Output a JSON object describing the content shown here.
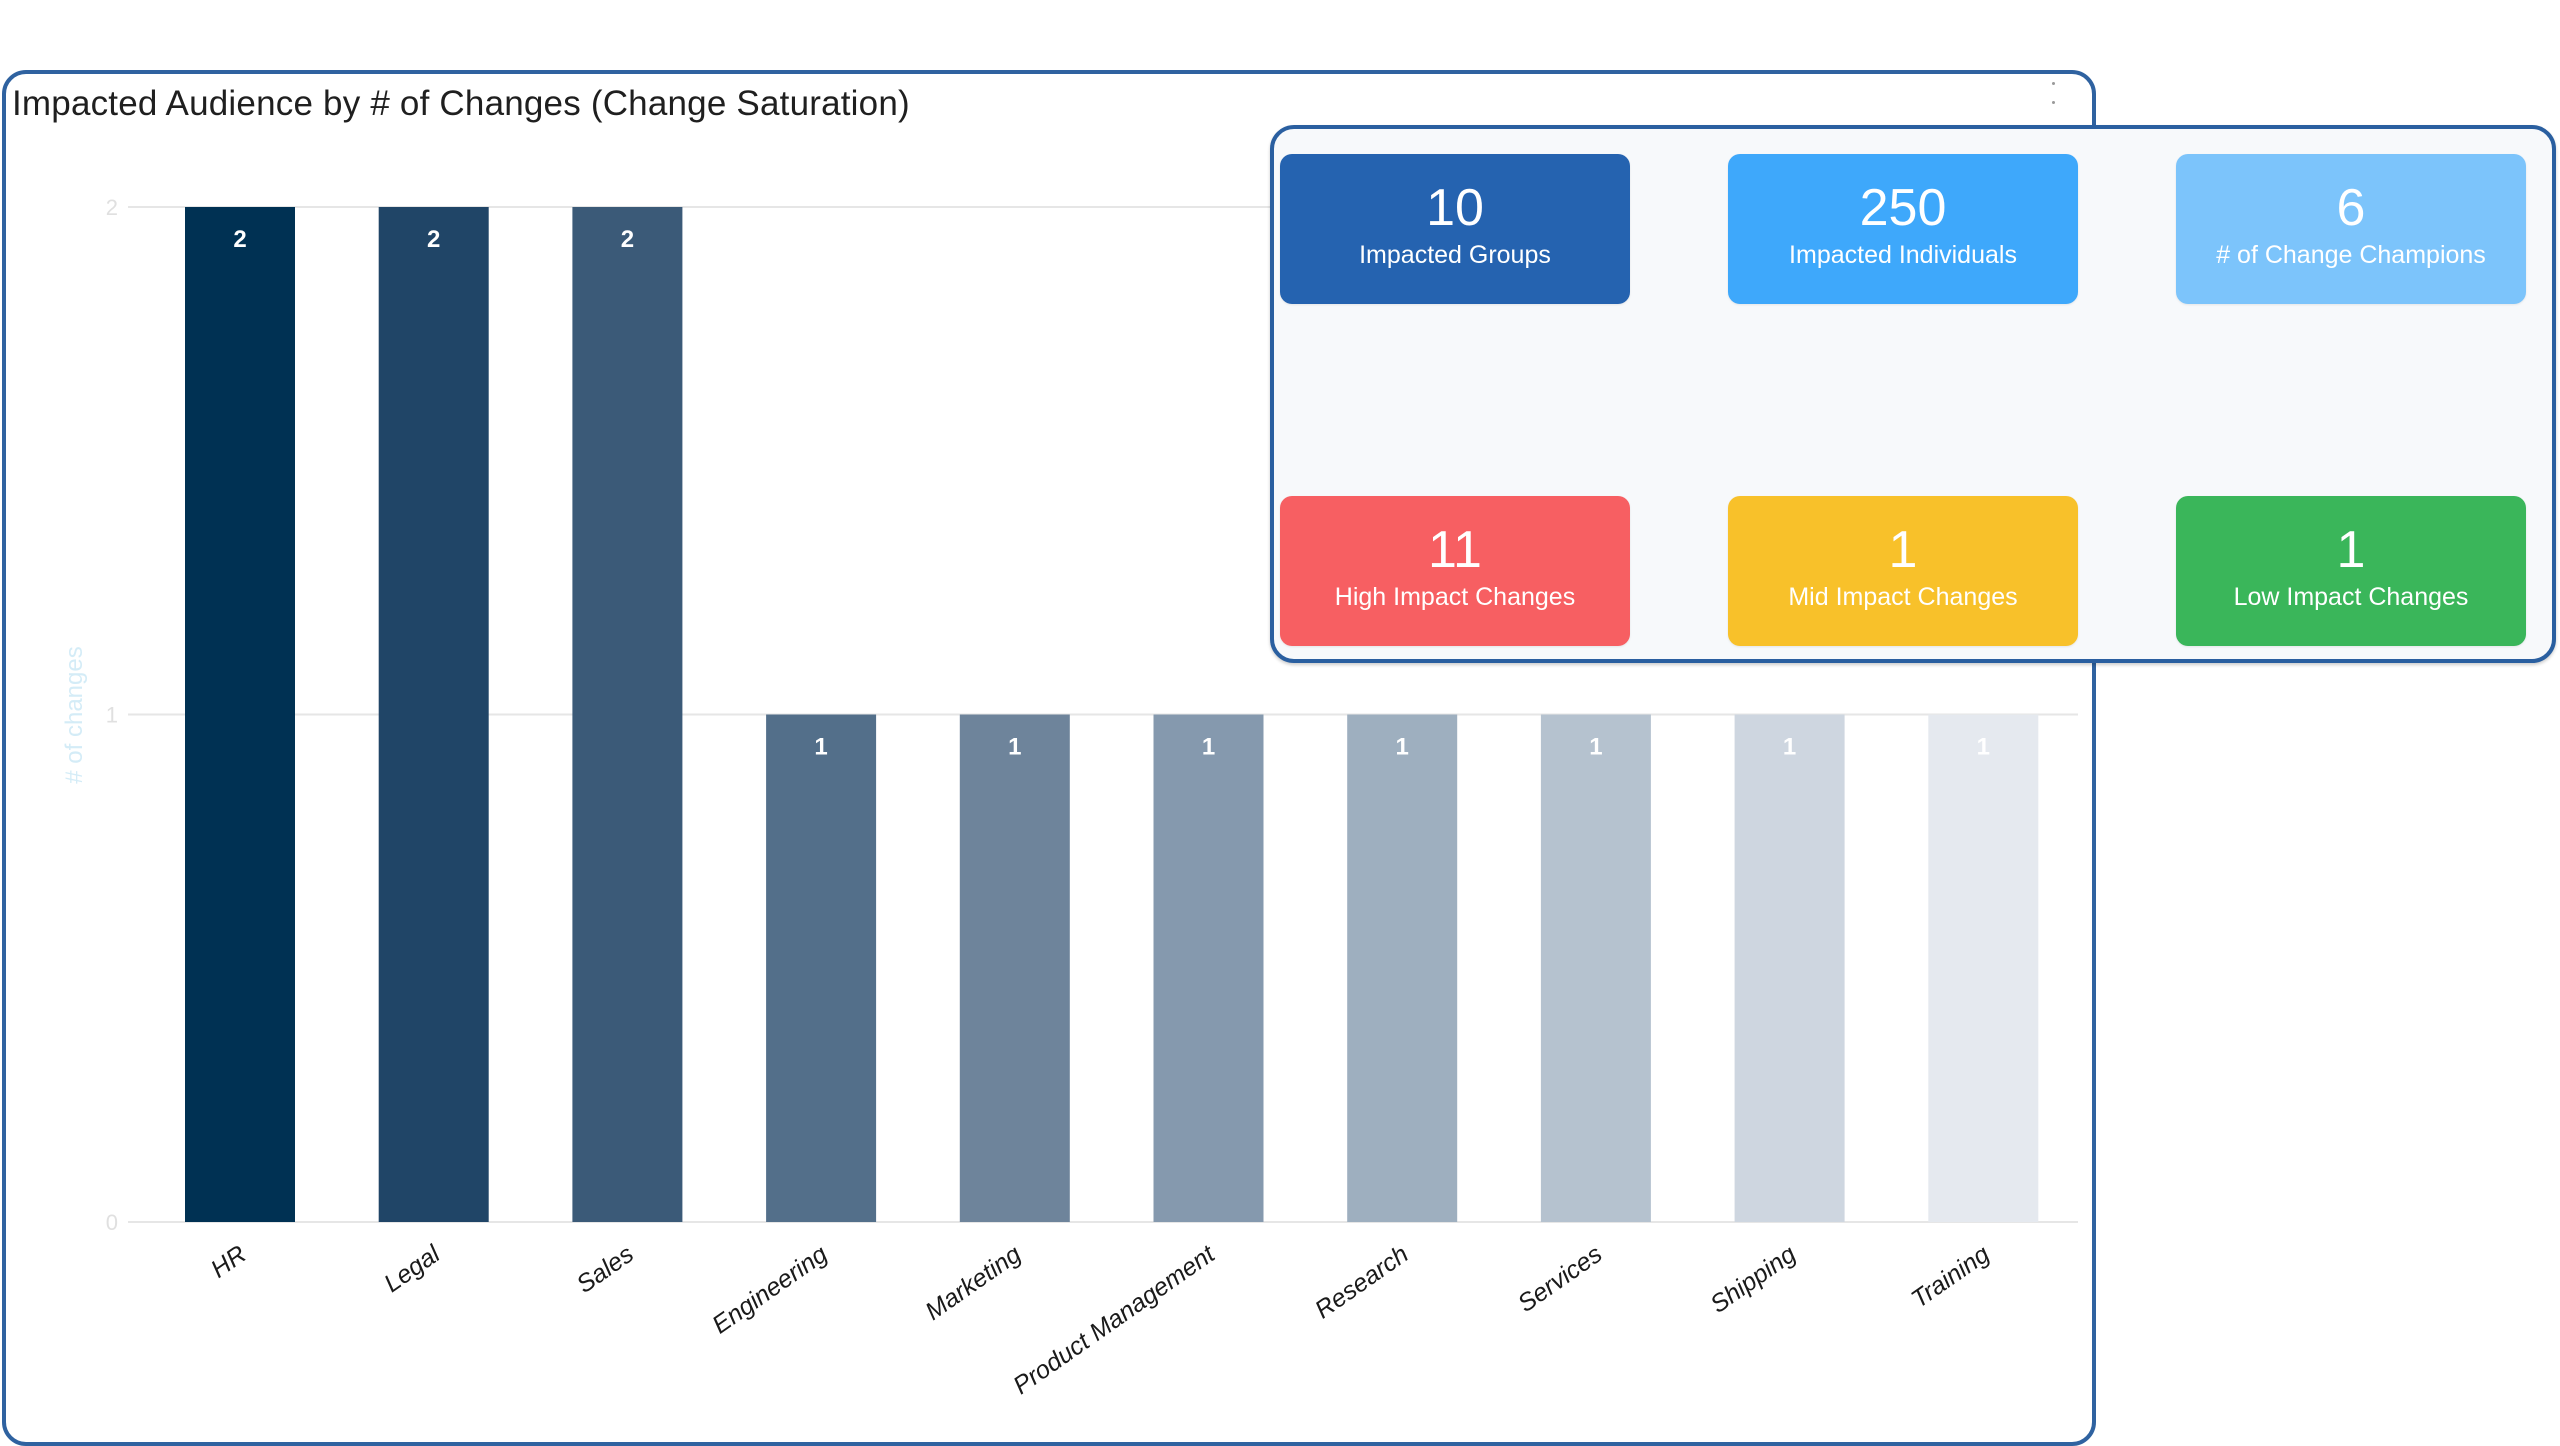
{
  "chart_card": {
    "title": "Impacted Audience by # of Changes (Change Saturation)",
    "menu_icon": "kebab-menu-icon"
  },
  "chart_data": {
    "type": "bar",
    "title": "Impacted Audience by # of Changes (Change Saturation)",
    "xlabel": "",
    "ylabel": "# of changes",
    "ylim": [
      0,
      2
    ],
    "yticks": [
      "0",
      "1",
      "2"
    ],
    "grid": true,
    "legend": "none",
    "categories": [
      "HR",
      "Legal",
      "Sales",
      "Engineering",
      "Marketing",
      "Product Management",
      "Research",
      "Services",
      "Shipping",
      "Training"
    ],
    "values": [
      2,
      2,
      2,
      1,
      1,
      1,
      1,
      1,
      1,
      1
    ],
    "data_labels": [
      "2",
      "2",
      "2",
      "1",
      "1",
      "1",
      "1",
      "1",
      "1",
      "1"
    ],
    "colors": [
      "#003153",
      "#204567",
      "#3b5a78",
      "#536f8a",
      "#6e849b",
      "#8599ae",
      "#9eafbf",
      "#b5c2cf",
      "#ced6e0",
      "#e5e9ef"
    ]
  },
  "stats": {
    "tiles": [
      {
        "value": "10",
        "label": "Impacted Groups",
        "color": "#2563b0"
      },
      {
        "value": "250",
        "label": "Impacted Individuals",
        "color": "#3ea8fb"
      },
      {
        "value": "6",
        "label": "# of Change Champions",
        "color": "#7cc4fb"
      },
      {
        "value": "11",
        "label": "High Impact Changes",
        "color": "#f75f62"
      },
      {
        "value": "1",
        "label": "Mid Impact Changes",
        "color": "#f8c12a"
      },
      {
        "value": "1",
        "label": "Low Impact Changes",
        "color": "#3ab65a"
      }
    ]
  }
}
